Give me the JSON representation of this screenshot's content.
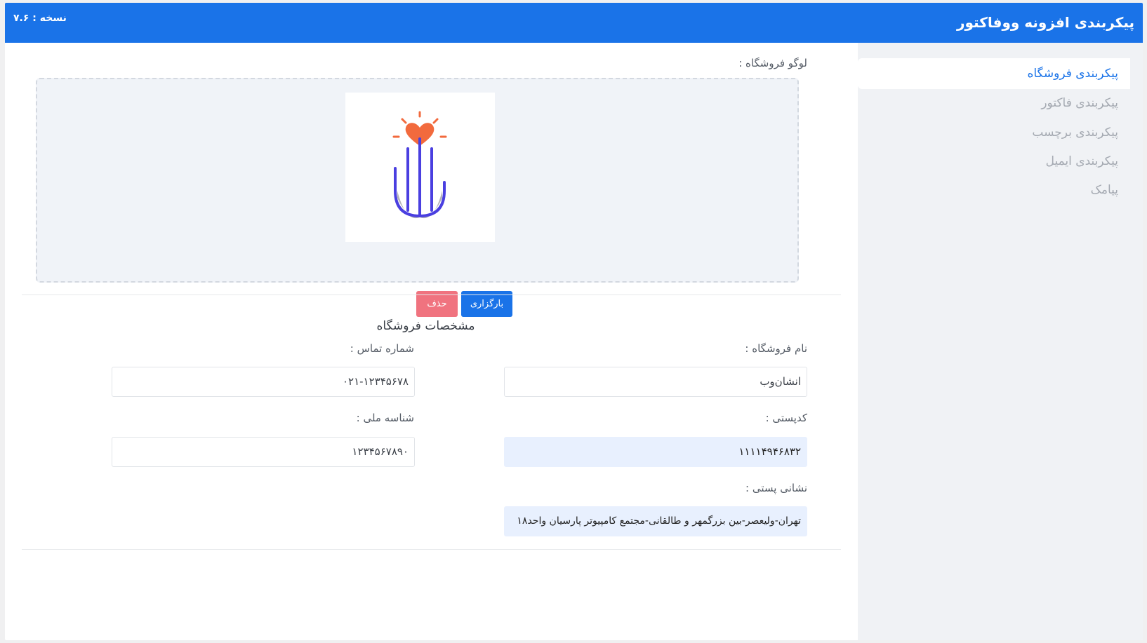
{
  "header": {
    "title": "پیکربندی افزونه ووفاکتور",
    "version": "نسخه : ۷.۶"
  },
  "sidebar": {
    "items": [
      {
        "label": "پیکربندی فروشگاه",
        "active": true
      },
      {
        "label": "پیکربندی فاکتور",
        "active": false
      },
      {
        "label": "پیکربندی برچسب",
        "active": false
      },
      {
        "label": "پیکربندی ایمیل",
        "active": false
      },
      {
        "label": "پیامک",
        "active": false
      }
    ]
  },
  "logo": {
    "label": "لوگو فروشگاه :",
    "upload_label": "بارگزاری",
    "delete_label": "حذف",
    "colors": {
      "heart": "#f26a3d",
      "stroke": "#4a3fe0",
      "shadow": "#b3b3b8"
    }
  },
  "store": {
    "section_title": "مشخصات فروشگاه",
    "name_label": "نام فروشگاه :",
    "name_value": "انشان‌وب",
    "phone_label": "شماره تماس :",
    "phone_value": "۰۲۱-۱۲۳۴۵۶۷۸",
    "postal_label": "کدپستی :",
    "postal_value": "۱۱۱۱۴۹۴۶۸۳۲",
    "national_id_label": "شناسه ملی :",
    "national_id_value": "۱۲۳۴۵۶۷۸۹۰",
    "address_label": "نشانی پستی :",
    "address_value": "تهران-ولیعصر-بین بزرگمهر و طالقانی-مجتمع کامپیوتر پارسیان واحد۱۸"
  },
  "colors": {
    "accent": "#1a73e8",
    "danger": "#f0737f",
    "autofill": "#e8f0fe"
  }
}
